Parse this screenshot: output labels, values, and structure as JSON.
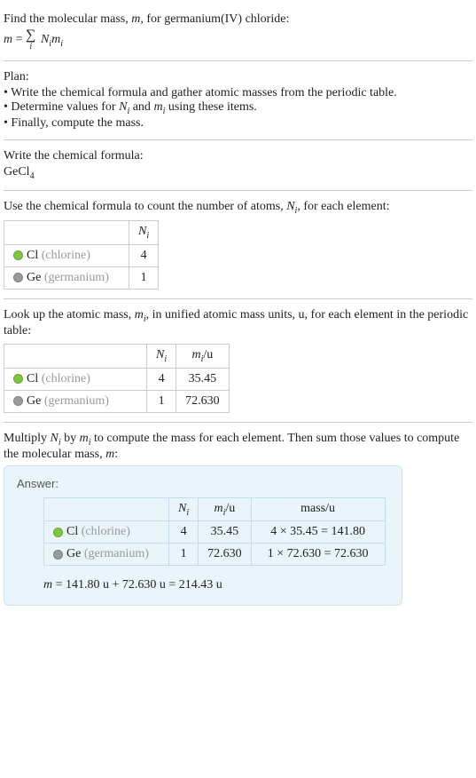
{
  "intro": {
    "line1": "Find the molecular mass, ",
    "mvar": "m",
    "line1b": ", for germanium(IV) chloride:",
    "eq_lhs": "m",
    "eq_eq": " = ",
    "eq_sum_idx": "i",
    "eq_term_N": "N",
    "eq_term_i": "i",
    "eq_term_m": "m",
    "eq_term_i2": "i"
  },
  "plan": {
    "heading": "Plan:",
    "items": [
      "Write the chemical formula and gather atomic masses from the periodic table.",
      "Determine values for N_i and m_i using these items.",
      "Finally, compute the mass."
    ],
    "item1": "Write the chemical formula and gather atomic masses from the periodic table.",
    "item2a": "Determine values for ",
    "item2_N": "N",
    "item2_i": "i",
    "item2b": " and ",
    "item2_m": "m",
    "item2_i2": "i",
    "item2c": " using these items.",
    "item3": "Finally, compute the mass."
  },
  "formula_section": {
    "heading": "Write the chemical formula:",
    "formula_base": "GeCl",
    "formula_sub": "4"
  },
  "count_section": {
    "heading_a": "Use the chemical formula to count the number of atoms, ",
    "heading_N": "N",
    "heading_i": "i",
    "heading_b": ", for each element:",
    "col_N": "N",
    "col_i": "i",
    "rows": [
      {
        "sym": "Cl",
        "full": "(chlorine)",
        "n": "4"
      },
      {
        "sym": "Ge",
        "full": "(germanium)",
        "n": "1"
      }
    ]
  },
  "mass_section": {
    "heading_a": "Look up the atomic mass, ",
    "heading_m": "m",
    "heading_i": "i",
    "heading_b": ", in unified atomic mass units, u, for each element in the periodic table:",
    "col_N": "N",
    "col_Ni": "i",
    "col_m": "m",
    "col_mi": "i",
    "col_mu": "/u",
    "rows": [
      {
        "sym": "Cl",
        "full": "(chlorine)",
        "n": "4",
        "m": "35.45"
      },
      {
        "sym": "Ge",
        "full": "(germanium)",
        "n": "1",
        "m": "72.630"
      }
    ]
  },
  "answer_section": {
    "intro_a": "Multiply ",
    "intro_N": "N",
    "intro_Ni": "i",
    "intro_b": " by ",
    "intro_m": "m",
    "intro_mi": "i",
    "intro_c": " to compute the mass for each element. Then sum those values to compute the molecular mass, ",
    "intro_mvar": "m",
    "intro_d": ":",
    "answer_label": "Answer:",
    "col_N": "N",
    "col_Ni": "i",
    "col_m": "m",
    "col_mi": "i",
    "col_mu": "/u",
    "col_mass": "mass/u",
    "rows": [
      {
        "sym": "Cl",
        "full": "(chlorine)",
        "n": "4",
        "m": "35.45",
        "calc": "4 × 35.45 = 141.80"
      },
      {
        "sym": "Ge",
        "full": "(germanium)",
        "n": "1",
        "m": "72.630",
        "calc": "1 × 72.630 = 72.630"
      }
    ],
    "result": "m = 141.80 u + 72.630 u = 214.43 u",
    "result_lhs": "m",
    "result_rest": " = 141.80 u + 72.630 u = 214.43 u"
  }
}
